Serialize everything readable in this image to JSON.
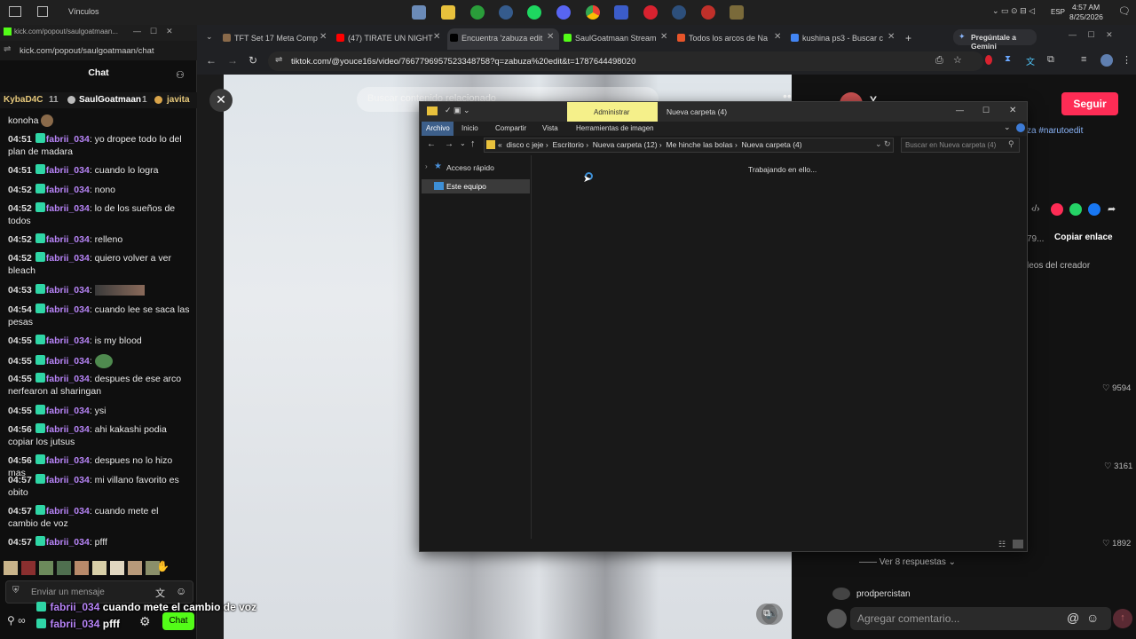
{
  "taskbar": {
    "title": "Vínculos",
    "lang": "ESP",
    "time": "4:57 AM",
    "date": "8/25/2026"
  },
  "popout": {
    "url": "kick.com/popout/saulgoatmaan/chat",
    "favicon_title": "kick.com/popout/saulgoatmaan...",
    "chat_title": "Chat"
  },
  "chat": {
    "top_users": [
      "KybaD4C",
      "11",
      "SaulGoatmaan",
      "1",
      "javita"
    ],
    "first_line": "konoha",
    "messages": [
      {
        "time": "04:51",
        "user": "fabrii_034",
        "text": ": yo dropee todo lo del plan de madara"
      },
      {
        "time": "04:51",
        "user": "fabrii_034",
        "text": ": cuando lo logra"
      },
      {
        "time": "04:52",
        "user": "fabrii_034",
        "text": ": nono"
      },
      {
        "time": "04:52",
        "user": "fabrii_034",
        "text": ": lo de los sueños de todos"
      },
      {
        "time": "04:52",
        "user": "fabrii_034",
        "text": ": relleno"
      },
      {
        "time": "04:52",
        "user": "fabrii_034",
        "text": ": quiero volver a ver bleach"
      },
      {
        "time": "04:53",
        "user": "fabrii_034",
        "text": ":"
      },
      {
        "time": "04:54",
        "user": "fabrii_034",
        "text": ": cuando lee se saca las pesas"
      },
      {
        "time": "04:55",
        "user": "fabrii_034",
        "text": ": is my blood"
      },
      {
        "time": "04:55",
        "user": "fabrii_034",
        "text": ":"
      },
      {
        "time": "04:55",
        "user": "fabrii_034",
        "text": ": despues de ese arco nerfearon al sharingan"
      },
      {
        "time": "04:55",
        "user": "fabrii_034",
        "text": ": ysi"
      },
      {
        "time": "04:56",
        "user": "fabrii_034",
        "text": ": ahi kakashi podia copiar los jutsus"
      },
      {
        "time": "04:56",
        "user": "fabrii_034",
        "text": ": despues no lo hizo mas"
      },
      {
        "time": "04:57",
        "user": "fabrii_034",
        "text": ": mi villano favorito es obito"
      },
      {
        "time": "04:57",
        "user": "fabrii_034",
        "text": ": cuando mete el cambio de voz"
      },
      {
        "time": "04:57",
        "user": "fabrii_034",
        "text": ": pfff"
      }
    ],
    "input_placeholder": "Enviar un mensaje",
    "send_label": "Chat",
    "overlay1_user": "fabrii_034",
    "overlay1_text": "cuando mete el cambio de voz",
    "overlay2_user": "fabrii_034",
    "overlay2_text": "pfff"
  },
  "browser": {
    "tabs": [
      {
        "label": "TFT Set 17 Meta Comp"
      },
      {
        "label": "(47) TIRATE UN NIGHT"
      },
      {
        "label": "Encuentra 'zabuza edit"
      },
      {
        "label": "SaulGoatmaan Stream"
      },
      {
        "label": "Todos los arcos de Na"
      },
      {
        "label": "kushina ps3 - Buscar c"
      }
    ],
    "gemini": "Pregúntale a Gemini",
    "url": "tiktok.com/@youce16s/video/7667796957523348758?q=zabuza%20edit&t=1787644498020"
  },
  "video": {
    "search_placeholder": "Buscar contenido relacionado"
  },
  "tiktok": {
    "follow_label": "Seguir",
    "hashtag": "za #narutoedit",
    "copy_link": "Copiar enlace",
    "link_prefix": "79...",
    "creator_videos": "leos del creador",
    "likes": [
      "9594",
      "3161",
      "1892"
    ],
    "more_replies": "Ver 8 respuestas",
    "commenter": "prodpercistan",
    "comment_placeholder": "Agregar comentario...",
    "avatar_letter": "Y"
  },
  "explorer": {
    "title": "Nueva carpeta (4)",
    "admin": "Administrar",
    "ribbon": [
      "Archivo",
      "Inicio",
      "Compartir",
      "Vista",
      "Herramientas de imagen"
    ],
    "path": [
      "disco c jeje",
      "Escritorio",
      "Nueva carpeta (12)",
      "Me hinche las bolas",
      "Nueva carpeta (4)"
    ],
    "search_placeholder": "Buscar en Nueva carpeta (4)",
    "nav": [
      "Acceso rápido",
      "Este equipo"
    ],
    "status": "Trabajando en ello..."
  }
}
